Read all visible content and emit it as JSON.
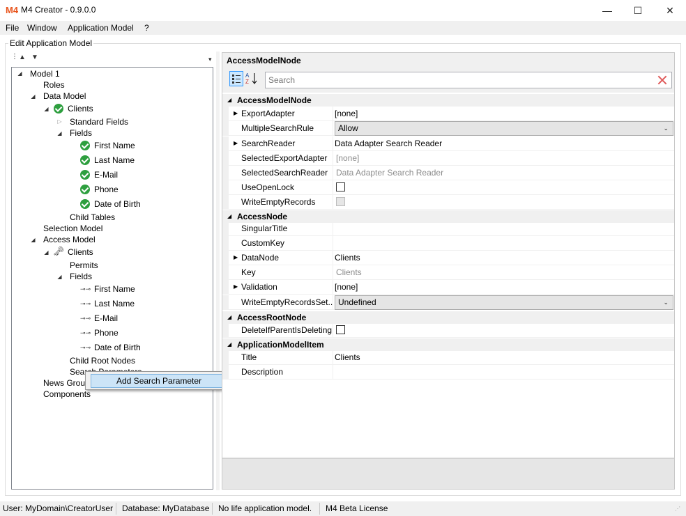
{
  "window": {
    "title": "M4 Creator - 0.9.0.0",
    "logo": "M4",
    "minimize": "—",
    "maximize": "☐",
    "close": "✕"
  },
  "menu": [
    "File",
    "Window",
    "Application Model",
    "?"
  ],
  "groupbox": {
    "label": "Edit Application Model"
  },
  "tree": {
    "model": "Model 1",
    "roles": "Roles",
    "data_model": "Data Model",
    "dm_clients": "Clients",
    "standard_fields": "Standard Fields",
    "fields": "Fields",
    "dm_fields": [
      "First Name",
      "Last Name",
      "E-Mail",
      "Phone",
      "Date of Birth"
    ],
    "child_tables": "Child Tables",
    "selection_model": "Selection Model",
    "access_model": "Access Model",
    "am_clients": "Clients",
    "permits": "Permits",
    "am_fields_label": "Fields",
    "am_fields": [
      "First Name",
      "Last Name",
      "E-Mail",
      "Phone",
      "Date of Birth"
    ],
    "child_root_nodes": "Child Root Nodes",
    "search_params": "Search Parameters",
    "news_groups": "News Groups",
    "components": "Components"
  },
  "context_menu": {
    "item": "Add Search Parameter"
  },
  "property_grid": {
    "title": "AccessModelNode",
    "search_placeholder": "Search",
    "categories": [
      {
        "name": "AccessModelNode",
        "props": [
          {
            "name": "ExportAdapter",
            "value": "[none]",
            "expandable": true,
            "kind": "text"
          },
          {
            "name": "MultipleSearchRule",
            "value": "Allow",
            "expandable": false,
            "kind": "combo"
          },
          {
            "name": "SearchReader",
            "value": "Data Adapter Search Reader",
            "expandable": true,
            "kind": "text"
          },
          {
            "name": "SelectedExportAdapter",
            "value": "[none]",
            "expandable": false,
            "kind": "readonly"
          },
          {
            "name": "SelectedSearchReader",
            "value": "Data Adapter Search Reader",
            "expandable": false,
            "kind": "readonly"
          },
          {
            "name": "UseOpenLock",
            "value": "",
            "expandable": false,
            "kind": "checkbox"
          },
          {
            "name": "WriteEmptyRecords",
            "value": "",
            "expandable": false,
            "kind": "checkbox-disabled"
          }
        ]
      },
      {
        "name": "AccessNode",
        "props": [
          {
            "name": "SingularTitle",
            "value": "",
            "expandable": false,
            "kind": "text"
          },
          {
            "name": "CustomKey",
            "value": "",
            "expandable": false,
            "kind": "text"
          },
          {
            "name": "DataNode",
            "value": "Clients",
            "expandable": true,
            "kind": "text"
          },
          {
            "name": "Key",
            "value": "Clients",
            "expandable": false,
            "kind": "readonly"
          },
          {
            "name": "Validation",
            "value": "[none]",
            "expandable": true,
            "kind": "text"
          },
          {
            "name": "WriteEmptyRecordsSet...",
            "value": "Undefined",
            "expandable": false,
            "kind": "combo"
          }
        ]
      },
      {
        "name": "AccessRootNode",
        "props": [
          {
            "name": "DeleteIfParentIsDeleting",
            "value": "",
            "expandable": false,
            "kind": "checkbox"
          }
        ]
      },
      {
        "name": "ApplicationModelItem",
        "props": [
          {
            "name": "Title",
            "value": "Clients",
            "expandable": false,
            "kind": "text"
          },
          {
            "name": "Description",
            "value": "",
            "expandable": false,
            "kind": "text"
          }
        ]
      }
    ]
  },
  "statusbar": {
    "user": "User: MyDomain\\CreatorUser",
    "database": "Database: MyDatabase",
    "model": "No life application model.",
    "license": "M4 Beta License"
  }
}
